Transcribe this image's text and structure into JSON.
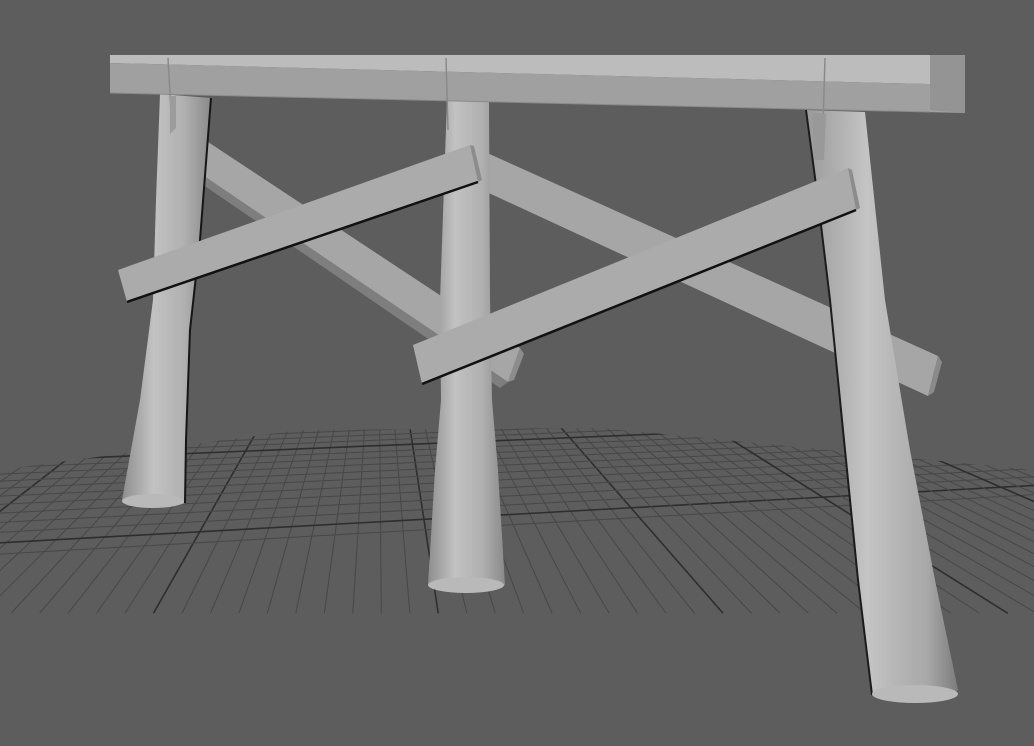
{
  "viewport": {
    "view": "perspective",
    "shading": "smooth-shaded",
    "show_grid": true
  },
  "colors": {
    "background": "#5d5d5d",
    "grid_line": "#474747",
    "grid_axis": "#2e2e2e",
    "mesh_light": "#bcbcbc",
    "mesh_mid": "#a3a3a3",
    "mesh_dark": "#858585",
    "mesh_edge": "#161616"
  },
  "scene": {
    "objects": [
      {
        "name": "top-beam",
        "type": "mesh"
      },
      {
        "name": "leg-left",
        "type": "mesh"
      },
      {
        "name": "leg-middle",
        "type": "mesh"
      },
      {
        "name": "leg-right",
        "type": "mesh"
      },
      {
        "name": "back-brace-left",
        "type": "mesh"
      },
      {
        "name": "back-brace-right",
        "type": "mesh"
      },
      {
        "name": "front-brace-left",
        "type": "mesh"
      },
      {
        "name": "front-brace-right",
        "type": "mesh"
      }
    ]
  }
}
